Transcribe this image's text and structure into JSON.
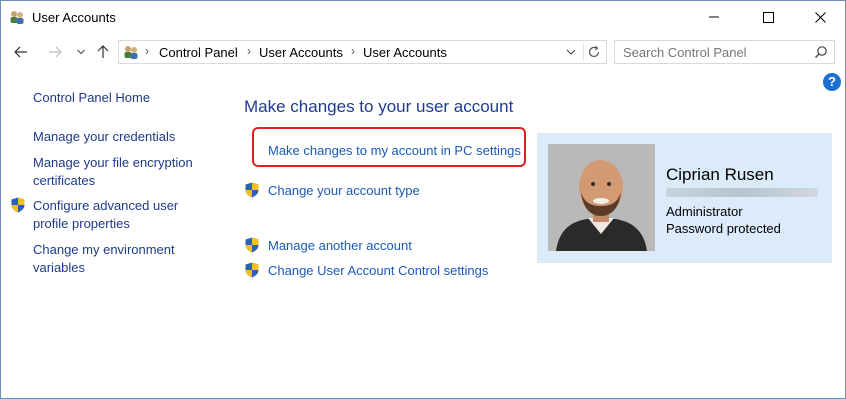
{
  "window": {
    "title": "User Accounts"
  },
  "address": {
    "crumbs": [
      "Control Panel",
      "User Accounts",
      "User Accounts"
    ],
    "search_placeholder": "Search Control Panel"
  },
  "help_label": "?",
  "sidebar": {
    "home": "Control Panel Home",
    "items": [
      {
        "label": "Manage your credentials"
      },
      {
        "label": "Manage your file encryption certificates"
      },
      {
        "label": "Configure advanced user profile properties"
      },
      {
        "label": "Change my environment variables"
      }
    ]
  },
  "main": {
    "heading": "Make changes to your user account",
    "tasks": [
      {
        "label": "Make changes to my account in PC settings"
      },
      {
        "label": "Change your account type"
      },
      {
        "label": "Manage another account"
      },
      {
        "label": "Change User Account Control settings"
      }
    ]
  },
  "user": {
    "name": "Ciprian Rusen",
    "role": "Administrator",
    "status": "Password protected"
  },
  "colors": {
    "link": "#1a5ab8",
    "heading": "#1e3b8f",
    "card_bg": "#dcebf9",
    "highlight": "#e02020"
  }
}
